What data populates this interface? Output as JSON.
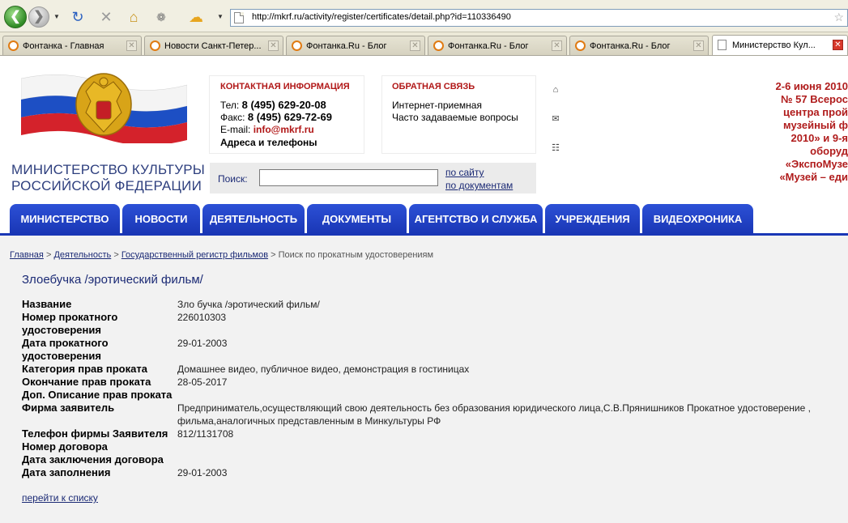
{
  "browser": {
    "url": "http://mkrf.ru/activity/register/certificates/detail.php?id=110336490",
    "tabs": [
      {
        "label": "Фонтанка - Главная",
        "active": false
      },
      {
        "label": "Новости Санкт-Петер...",
        "active": false
      },
      {
        "label": "Фонтанка.Ru - Блог",
        "active": false
      },
      {
        "label": "Фонтанка.Ru - Блог",
        "active": false
      },
      {
        "label": "Фонтанка.Ru - Блог",
        "active": false
      },
      {
        "label": "Министерство Кул...",
        "active": true
      }
    ],
    "icons": [
      "back-icon",
      "forward-icon",
      "reload-icon",
      "stop-icon",
      "home-icon",
      "addon-icon",
      "weather-icon",
      "bookmark-star-icon"
    ]
  },
  "header": {
    "logo_line1": "МИНИСТЕРСТВО КУЛЬТУРЫ",
    "logo_line2": "РОССИЙСКОЙ ФЕДЕРАЦИИ",
    "contact": {
      "heading": "КОНТАКТНАЯ ИНФОРМАЦИЯ",
      "tel_label": "Тел:",
      "tel": "8 (495) 629-20-08",
      "fax_label": "Факс:",
      "fax": "8 (495) 629-72-69",
      "email_label": "E-mail:",
      "email": "info@mkrf.ru",
      "addresses": "Адреса и телефоны"
    },
    "feedback": {
      "heading": "ОБРАТНАЯ СВЯЗЬ",
      "link1": "Интернет-приемная",
      "link2": "Часто задаваемые вопросы"
    },
    "search": {
      "label": "Поиск:",
      "value": "",
      "scope_site": "по сайту",
      "scope_docs": "по документам"
    },
    "promo_lines": [
      "2-6 июня 2010",
      "№ 57 Всерос",
      "центра прой",
      "музейный ф",
      "2010» и 9-я",
      "оборуд",
      "«ЭкспоМузе",
      "«Музей – еди"
    ]
  },
  "menu": [
    "МИНИСТЕРСТВО",
    "НОВОСТИ",
    "ДЕЯТЕЛЬНОСТЬ",
    "ДОКУМЕНТЫ",
    "АГЕНТСТВО И СЛУЖБА",
    "УЧРЕЖДЕНИЯ",
    "ВИДЕОХРОНИКА"
  ],
  "breadcrumb": {
    "home": "Главная",
    "activity": "Деятельность",
    "register": "Государственный регистр фильмов",
    "sep": ">",
    "current": "Поиск по прокатным удостоверениям"
  },
  "film": {
    "title": "Злоебучка /эротический фильм/",
    "rows": [
      {
        "label": "Название",
        "value": "Зло  бучка /эротический фильм/"
      },
      {
        "label": "Номер прокатного удостоверения",
        "value": "226010303"
      },
      {
        "label": "Дата прокатного удостоверения",
        "value": "29-01-2003"
      },
      {
        "label": "Категория прав проката",
        "value": "Домашнее видео, публичное видео, демонстрация в гостиницах"
      },
      {
        "label": "Окончание прав проката",
        "value": "28-05-2017"
      },
      {
        "label": "Доп. Описание прав проката",
        "value": ""
      },
      {
        "label": "Фирма заявитель",
        "value": "Предприниматель,осуществляющий свою деятельность без образования юридического лица,С.В.Прянишников Прокатное удостоверение ,",
        "value2": "фильма,аналогичных представленным в Минкультуры РФ"
      },
      {
        "label": "Телефон фирмы Заявителя",
        "value": "812/1131708"
      },
      {
        "label": "Номер договора",
        "value": ""
      },
      {
        "label": "Дата заключения договора",
        "value": ""
      },
      {
        "label": "Дата заполнения",
        "value": "29-01-2003"
      }
    ],
    "back_link": "перейти к списку"
  }
}
